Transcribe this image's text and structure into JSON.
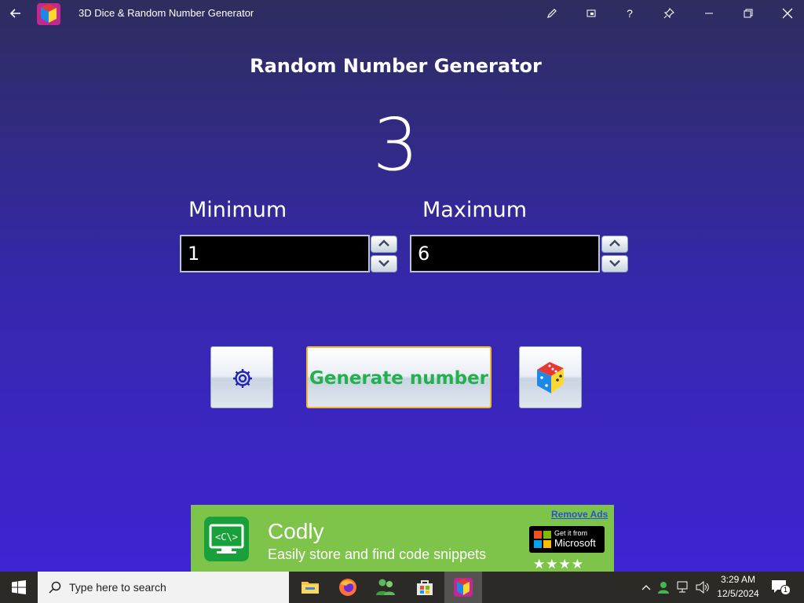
{
  "window": {
    "title": "3D Dice & Random Number Generator",
    "back_icon": "arrow-left-icon",
    "buttons": [
      "pen-icon",
      "compact-overlay-icon",
      "help-icon",
      "pin-icon",
      "minimize-icon",
      "restore-icon",
      "close-icon"
    ],
    "help_label": "?"
  },
  "main": {
    "heading": "Random Number Generator",
    "result": "3",
    "minimum": {
      "label": "Minimum",
      "value": "1"
    },
    "maximum": {
      "label": "Maximum",
      "value": "6"
    },
    "buttons": {
      "settings_icon": "gear-icon",
      "generate_label": "Generate number",
      "dice_icon": "3d-dice-icon"
    }
  },
  "ad": {
    "title": "Codly",
    "subtitle": "Easily store and find code snippets",
    "remove_label": "Remove Ads",
    "store_small": "Get it from",
    "store_big": "Microsoft",
    "icon_text": "<C\\>",
    "stars": "★★★★"
  },
  "taskbar": {
    "search_placeholder": "Type here to search",
    "time": "3:29 AM",
    "date": "12/5/2024",
    "notification_count": "1",
    "apps": [
      "file-explorer-icon",
      "firefox-icon",
      "people-icon",
      "microsoft-store-icon",
      "3d-dice-app-icon"
    ]
  },
  "colors": {
    "background_top": "#2e2d5e",
    "background_bottom": "#3f23d8",
    "generate_text": "#22b14c",
    "generate_border": "#f2b735",
    "ad_background": "#7ec34a"
  }
}
